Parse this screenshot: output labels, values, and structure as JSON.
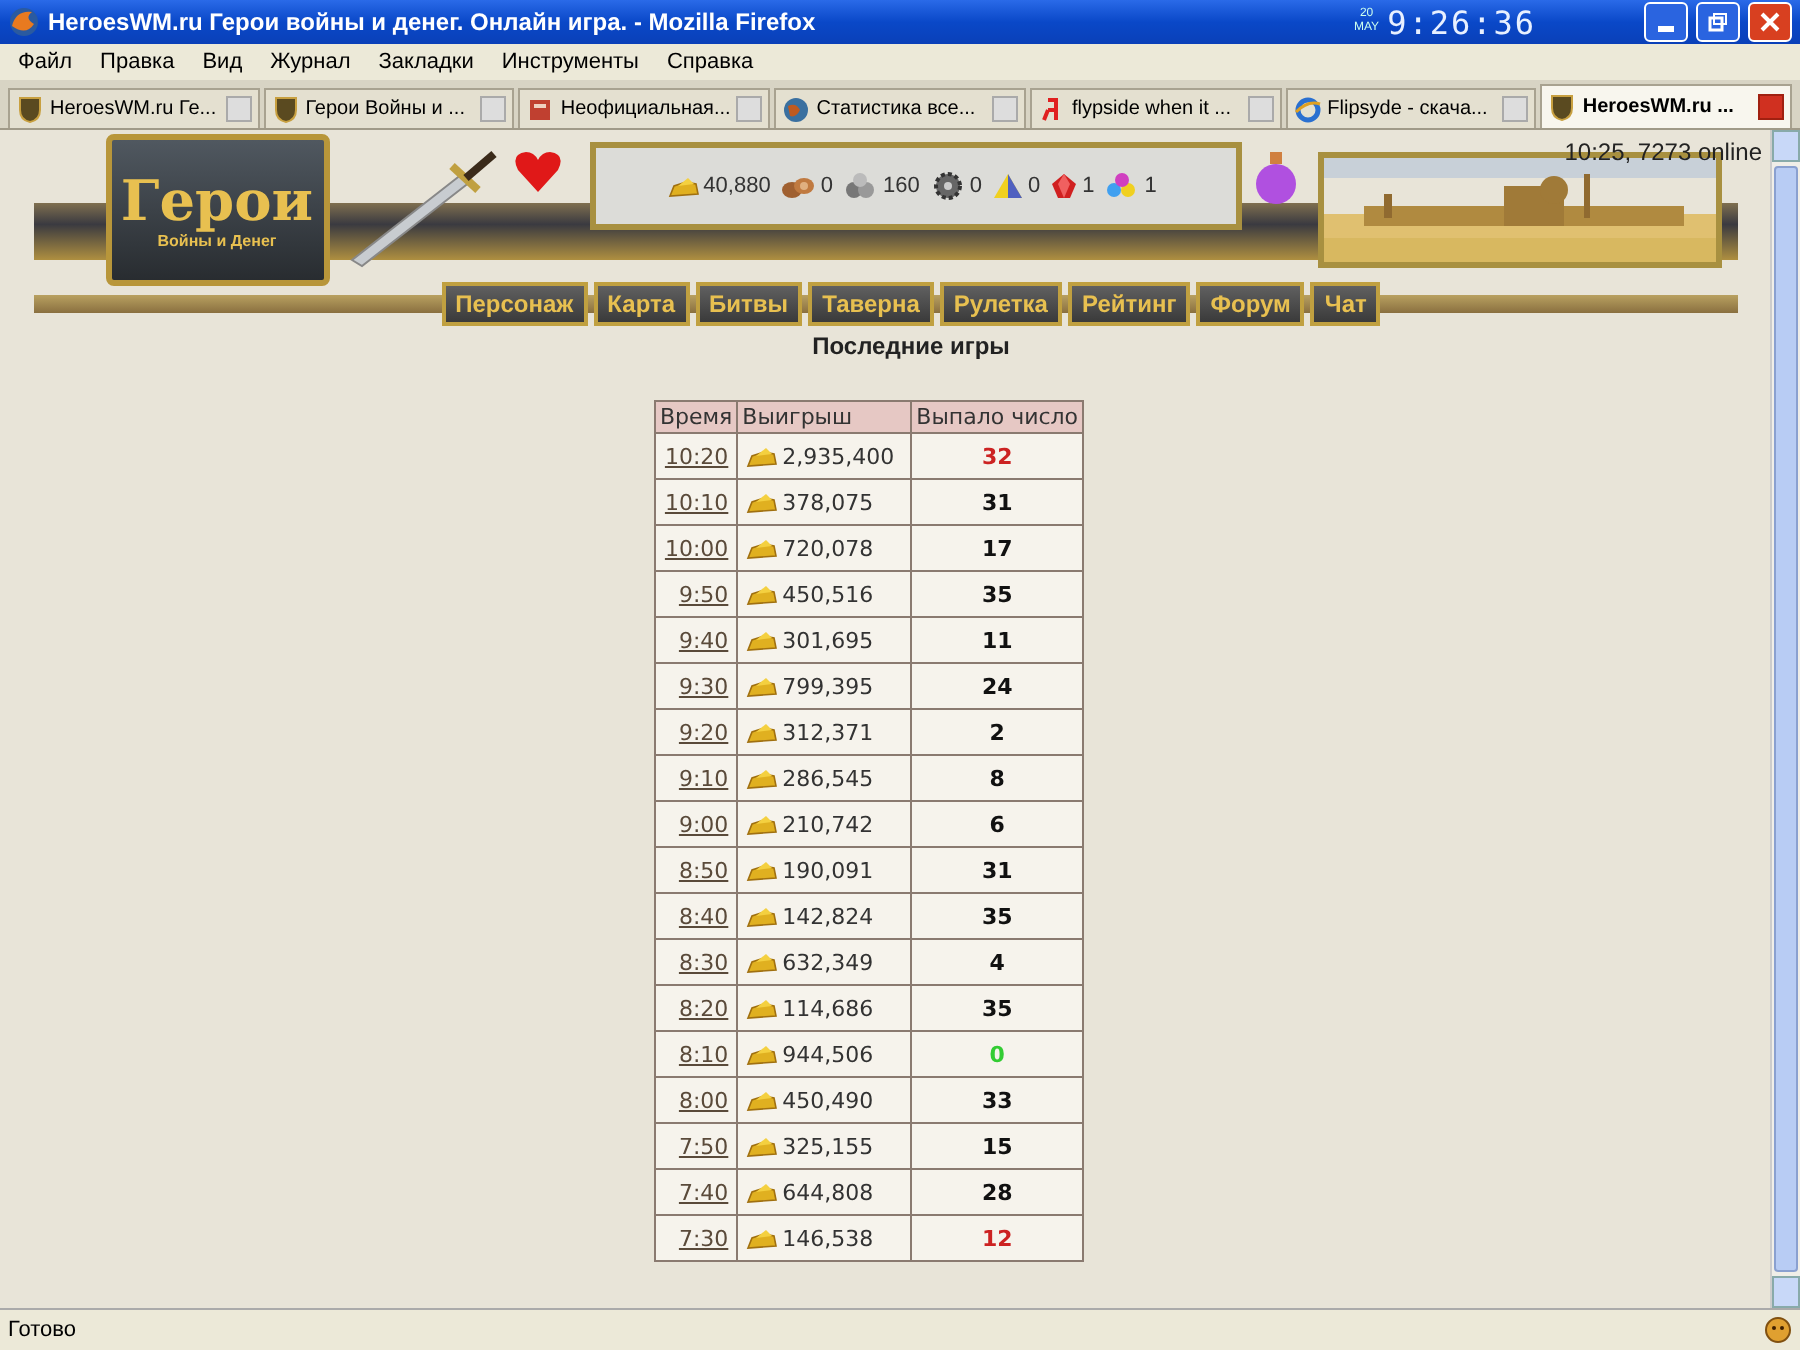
{
  "window": {
    "title": "HeroesWM.ru Герои войны и денег. Онлайн игра. - Mozilla Firefox",
    "clock_day": "20",
    "clock_month": "MAY",
    "clock": "9:26:36"
  },
  "menu": [
    "Файл",
    "Правка",
    "Вид",
    "Журнал",
    "Закладки",
    "Инструменты",
    "Справка"
  ],
  "tabs": [
    {
      "label": "HeroesWM.ru Ге...",
      "kind": "shield",
      "selected": false
    },
    {
      "label": "Герои Войны и ...",
      "kind": "shield",
      "selected": false
    },
    {
      "label": "Неофициальная...",
      "kind": "book",
      "selected": false
    },
    {
      "label": "Статистика все...",
      "kind": "globe",
      "selected": false
    },
    {
      "label": "flypside when it ...",
      "kind": "yandex",
      "selected": false
    },
    {
      "label": "Flipsyde - скача...",
      "kind": "ie",
      "selected": false
    },
    {
      "label": "HeroesWM.ru ...",
      "kind": "shield",
      "selected": true
    }
  ],
  "header": {
    "logo_title": "Герои",
    "logo_subtitle": "Войны и Денег",
    "online": "10:25, 7273 online",
    "resources": [
      {
        "kind": "gold",
        "value": "40,880"
      },
      {
        "kind": "wood",
        "value": "0"
      },
      {
        "kind": "ore",
        "value": "160"
      },
      {
        "kind": "mercury",
        "value": "0"
      },
      {
        "kind": "sulfur",
        "value": "0"
      },
      {
        "kind": "crystal",
        "value": "1"
      },
      {
        "kind": "gems",
        "value": "1"
      }
    ],
    "nav": [
      "Персонаж",
      "Карта",
      "Битвы",
      "Таверна",
      "Рулетка",
      "Рейтинг",
      "Форум",
      "Чат"
    ]
  },
  "heading": "Последние игры",
  "table": {
    "columns": [
      "Время",
      "Выигрыш",
      "Выпало число"
    ],
    "rows": [
      {
        "time": "10:20",
        "win": "2,935,400",
        "number": "32",
        "color": "#cc2222"
      },
      {
        "time": "10:10",
        "win": "378,075",
        "number": "31",
        "color": "#111111"
      },
      {
        "time": "10:00",
        "win": "720,078",
        "number": "17",
        "color": "#111111"
      },
      {
        "time": "9:50",
        "win": "450,516",
        "number": "35",
        "color": "#111111"
      },
      {
        "time": "9:40",
        "win": "301,695",
        "number": "11",
        "color": "#111111"
      },
      {
        "time": "9:30",
        "win": "799,395",
        "number": "24",
        "color": "#111111"
      },
      {
        "time": "9:20",
        "win": "312,371",
        "number": "2",
        "color": "#111111"
      },
      {
        "time": "9:10",
        "win": "286,545",
        "number": "8",
        "color": "#111111"
      },
      {
        "time": "9:00",
        "win": "210,742",
        "number": "6",
        "color": "#111111"
      },
      {
        "time": "8:50",
        "win": "190,091",
        "number": "31",
        "color": "#111111"
      },
      {
        "time": "8:40",
        "win": "142,824",
        "number": "35",
        "color": "#111111"
      },
      {
        "time": "8:30",
        "win": "632,349",
        "number": "4",
        "color": "#111111"
      },
      {
        "time": "8:20",
        "win": "114,686",
        "number": "35",
        "color": "#111111"
      },
      {
        "time": "8:10",
        "win": "944,506",
        "number": "0",
        "color": "#33cc33"
      },
      {
        "time": "8:00",
        "win": "450,490",
        "number": "33",
        "color": "#111111"
      },
      {
        "time": "7:50",
        "win": "325,155",
        "number": "15",
        "color": "#111111"
      },
      {
        "time": "7:40",
        "win": "644,808",
        "number": "28",
        "color": "#111111"
      },
      {
        "time": "7:30",
        "win": "146,538",
        "number": "12",
        "color": "#cc2222"
      }
    ]
  },
  "status_bar": "Готово"
}
